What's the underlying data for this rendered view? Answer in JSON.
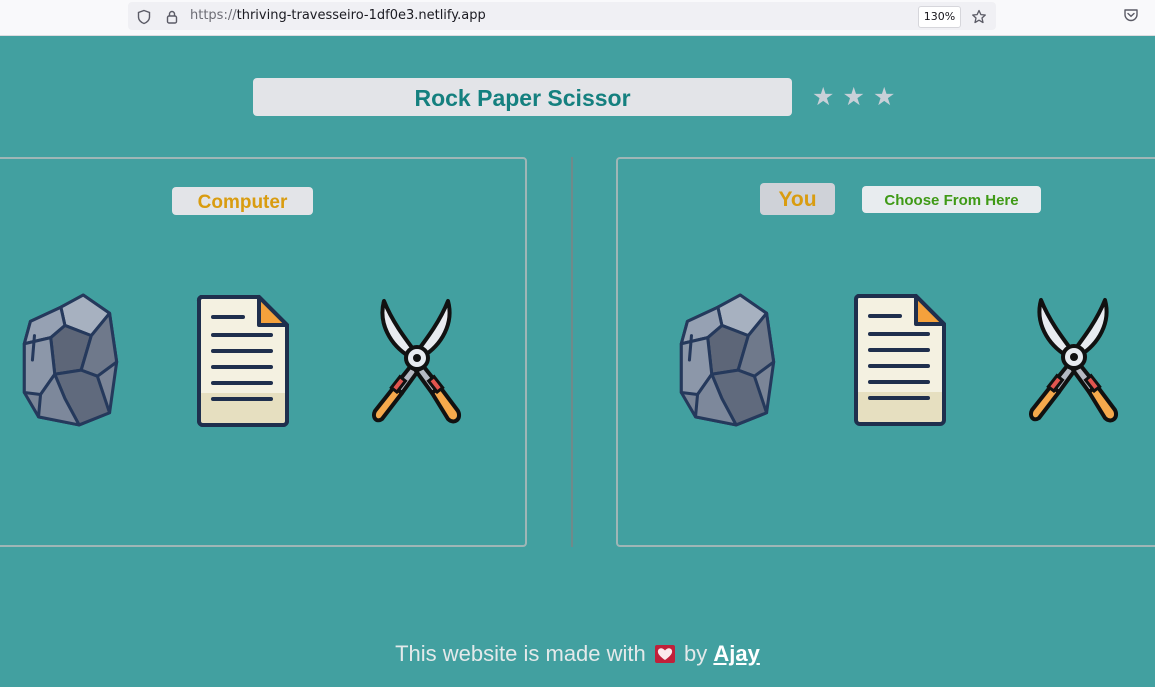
{
  "browser": {
    "url_scheme": "https://",
    "url_host": "thriving-travesseiro-1df0e3.netlify.app",
    "zoom": "130%"
  },
  "game": {
    "title": "Rock Paper Scissor",
    "stars": [
      "★",
      "★",
      "★"
    ],
    "computer_label": "Computer",
    "you_label": "You",
    "choose_label": "Choose From Here",
    "choices": [
      "rock",
      "paper",
      "scissors"
    ]
  },
  "footer": {
    "text_before": "This website is made with",
    "text_by": "by",
    "author": " Ajay"
  },
  "colors": {
    "background": "#42a0a0",
    "title": "#15807f",
    "label_orange": "#d99c10",
    "label_green": "#3f9a16"
  }
}
